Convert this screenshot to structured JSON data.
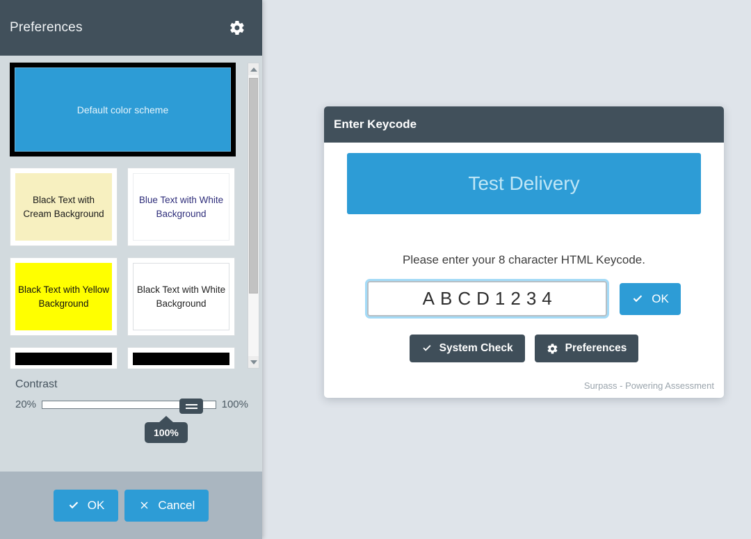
{
  "preferences_panel": {
    "title": "Preferences",
    "gear_icon": "gear-icon",
    "schemes": [
      {
        "label": "Default color scheme",
        "type": "wide-selected",
        "bg": "#2d9cd6",
        "fg": "#e6f4fb",
        "selected": true
      },
      {
        "label": "Black Text with Cream Background",
        "type": "card",
        "bg": "#f7f0c0",
        "fg": "#1a1a1a",
        "selected": false
      },
      {
        "label": "Blue Text with White Background",
        "type": "card",
        "bg": "#ffffff",
        "fg": "#2e2d7a",
        "selected": false
      },
      {
        "label": "Black Text with Yellow Background",
        "type": "card",
        "bg": "#ffff00",
        "fg": "#111111",
        "selected": false
      },
      {
        "label": "Black Text with White Background",
        "type": "card",
        "bg": "#ffffff",
        "fg": "#222222",
        "selected": false
      },
      {
        "label": "",
        "type": "card-clipped",
        "bg": "#000000",
        "fg": "#ffffff",
        "selected": false
      },
      {
        "label": "",
        "type": "card-clipped",
        "bg": "#000000",
        "fg": "#ffffff",
        "selected": false
      }
    ],
    "scrollbar": {
      "up_arrow": "chevron-up-icon",
      "down_arrow": "chevron-down-icon"
    },
    "contrast": {
      "label": "Contrast",
      "min_label": "20%",
      "max_label": "100%",
      "value": "100%",
      "tooltip": "100%"
    },
    "footer": {
      "ok_label": "OK",
      "ok_icon": "check-icon",
      "cancel_label": "Cancel",
      "cancel_icon": "close-x-icon"
    }
  },
  "keycode_dialog": {
    "title": "Enter Keycode",
    "banner_text": "Test Delivery",
    "instruction": "Please enter your 8 character HTML Keycode.",
    "keycode_value": "ABCD1234",
    "keycode_placeholder": "",
    "ok_label": "OK",
    "ok_icon": "check-icon",
    "system_check_label": "System Check",
    "system_check_icon": "check-icon",
    "preferences_label": "Preferences",
    "preferences_icon": "gear-icon",
    "brand": "Surpass - Powering Assessment"
  },
  "colors": {
    "accent_blue": "#2d9cd6",
    "dark_slate": "#41505b",
    "page_bg": "#dfe4ea",
    "panel_bg": "#d2dade",
    "panel_footer": "#aab6c0"
  }
}
